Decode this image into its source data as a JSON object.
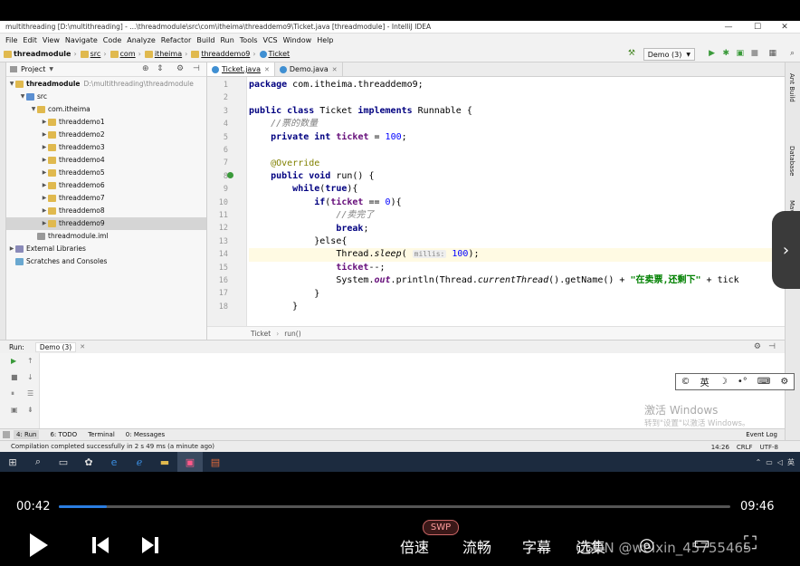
{
  "window": {
    "title": "multithreading [D:\\multithreading] - ...\\threadmodule\\src\\com\\itheima\\threaddemo9\\Ticket.java [threadmodule] - IntelliJ IDEA",
    "controls": [
      "—",
      "☐",
      "✕"
    ]
  },
  "menubar": [
    "File",
    "Edit",
    "View",
    "Navigate",
    "Code",
    "Analyze",
    "Refactor",
    "Build",
    "Run",
    "Tools",
    "VCS",
    "Window",
    "Help"
  ],
  "navbar": {
    "crumbs": [
      "threadmodule",
      "src",
      "com",
      "itheima",
      "threaddemo9",
      "Ticket"
    ],
    "run_config": "Demo (3)"
  },
  "project": {
    "header": "Project",
    "root_name": "threadmodule",
    "root_path": "D:\\multithreading\\threadmodule",
    "src": "src",
    "package": "com.itheima",
    "packages": [
      "threaddemo1",
      "threaddemo2",
      "threaddemo3",
      "threaddemo4",
      "threaddemo5",
      "threaddemo6",
      "threaddemo7",
      "threaddemo8",
      "threaddemo9"
    ],
    "iml": "threadmodule.iml",
    "external": "External Libraries",
    "scratches": "Scratches and Consoles"
  },
  "editor": {
    "tabs": [
      "Ticket.java",
      "Demo.java"
    ],
    "line_numbers": [
      "1",
      "2",
      "3",
      "4",
      "5",
      "6",
      "7",
      "8",
      "9",
      "10",
      "11",
      "12",
      "13",
      "14",
      "15",
      "16",
      "17",
      "18"
    ],
    "code": {
      "l1_kw": "package",
      "l1_rest": " com.itheima.threaddemo9;",
      "l3_kw1": "public class",
      "l3_mid": " Ticket ",
      "l3_kw2": "implements",
      "l3_rest": " Runnable {",
      "l4_comment": "//票的数量",
      "l5_kw": "private int",
      "l5_field": "ticket",
      "l5_eq": " = ",
      "l5_num": "100",
      "l5_end": ";",
      "l7_ann": "@Override",
      "l8_kw": "public void",
      "l8_rest": " run() {",
      "l9_kw": "while",
      "l9_p1": "(",
      "l9_kw2": "true",
      "l9_p2": "){",
      "l10_kw": "if",
      "l10_p": "(",
      "l10_field": "ticket",
      "l10_op": " == ",
      "l10_num": "0",
      "l10_end": "){",
      "l11_comment": "//卖完了",
      "l12_kw": "break",
      "l12_end": ";",
      "l13_text": "}else{",
      "l14_a": "Thread.",
      "l14_method": "sleep",
      "l14_b": "( ",
      "l14_hint": "millis:",
      "l14_num": " 100",
      "l14_end": ");",
      "l15_field": "ticket",
      "l15_end": "--;",
      "l16_a": "System.",
      "l16_out": "out",
      "l16_b": ".println(Thread.",
      "l16_ct": "currentThread",
      "l16_c": "().getName() + ",
      "l16_str": "\"在卖票,还剩下\"",
      "l16_d": " + tick",
      "l17_text": "}",
      "l18_text": "}"
    },
    "breadcrumb": [
      "Ticket",
      "run()"
    ]
  },
  "right_strip": [
    "Ant Build",
    "Database",
    "Maven Projects"
  ],
  "run": {
    "label": "Run:",
    "tab": "Demo (3)"
  },
  "ime": [
    "©",
    "英",
    "☽",
    "•°",
    "⌨",
    "⚙"
  ],
  "watermark": {
    "line1": "激活 Windows",
    "line2": "转到\"设置\"以激活 Windows。"
  },
  "bottom_tabs": [
    "4: Run",
    "6: TODO",
    "Terminal",
    "0: Messages"
  ],
  "event_log": "Event Log",
  "status": {
    "message": "Compilation completed successfully in 2 s 49 ms (a minute ago)",
    "position": "14:26",
    "line_sep": "CRLF",
    "encoding": "UTF-8"
  },
  "player": {
    "current": "00:42",
    "duration": "09:46",
    "progress": 0.0717,
    "badge": "SWP",
    "labels": [
      "倍速",
      "流畅",
      "字幕",
      "选集"
    ],
    "watermark": "CSDN @weixin_45755465"
  }
}
